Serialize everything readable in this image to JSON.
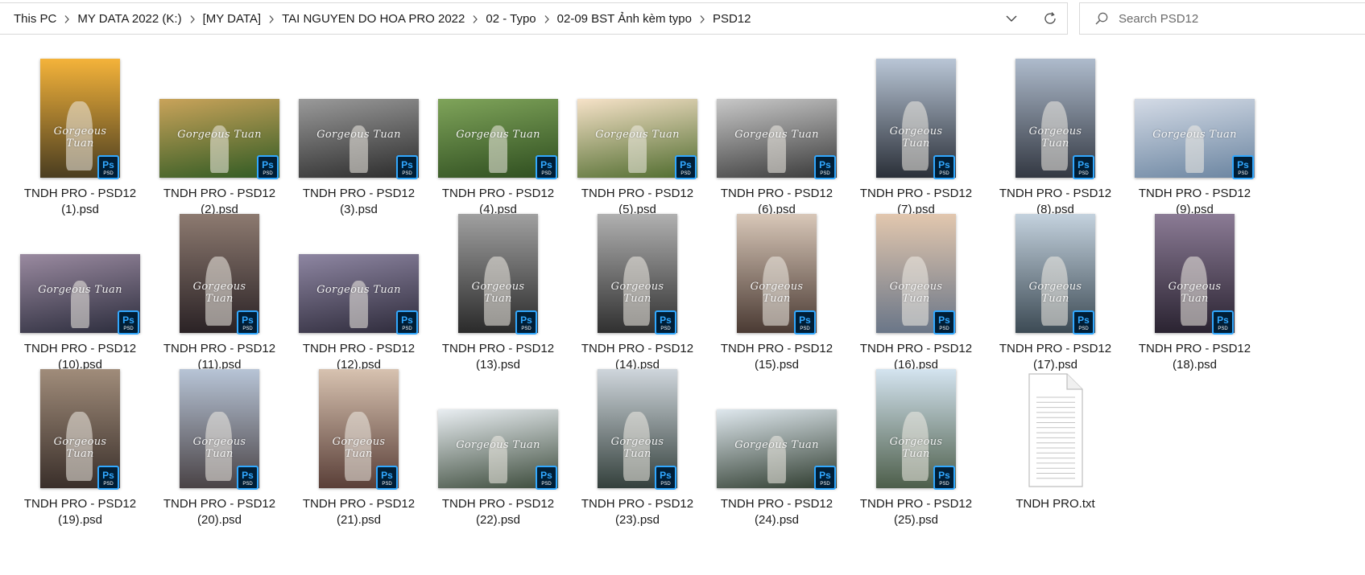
{
  "address_bar": {
    "breadcrumbs": [
      "This PC",
      "MY DATA 2022 (K:)",
      "[MY DATA]",
      "TAI NGUYEN DO HOA PRO 2022",
      "02 - Typo",
      "02-09 BST Ảnh kèm typo",
      "PSD12"
    ]
  },
  "search": {
    "placeholder": "Search PSD12"
  },
  "thumb_script": "Gorgeous Tuan",
  "ps_badge": {
    "top": "Ps",
    "bottom": "PSD"
  },
  "files": [
    {
      "line1": "TNDH PRO - PSD12",
      "line2": "(1).psd",
      "shape": "portrait",
      "c1": "#f4b33a",
      "c2": "#4a3d20"
    },
    {
      "line1": "TNDH PRO - PSD12",
      "line2": "(2).psd",
      "shape": "landscape",
      "c1": "#c9a35a",
      "c2": "#2f5a23"
    },
    {
      "line1": "TNDH PRO - PSD12",
      "line2": "(3).psd",
      "shape": "landscape",
      "c1": "#9a9a9a",
      "c2": "#2b2b2b"
    },
    {
      "line1": "TNDH PRO - PSD12",
      "line2": "(4).psd",
      "shape": "landscape",
      "c1": "#7fa45a",
      "c2": "#2e4d1f"
    },
    {
      "line1": "TNDH PRO - PSD12",
      "line2": "(5).psd",
      "shape": "landscape",
      "c1": "#f6e2c8",
      "c2": "#4f6b2d"
    },
    {
      "line1": "TNDH PRO - PSD12",
      "line2": "(6).psd",
      "shape": "landscape",
      "c1": "#c8c8c8",
      "c2": "#3a3a3a"
    },
    {
      "line1": "TNDH PRO - PSD12",
      "line2": "(7).psd",
      "shape": "portrait",
      "c1": "#b9c6d6",
      "c2": "#2a2f38"
    },
    {
      "line1": "TNDH PRO - PSD12",
      "line2": "(8).psd",
      "shape": "portrait",
      "c1": "#aebbcc",
      "c2": "#333842"
    },
    {
      "line1": "TNDH PRO - PSD12",
      "line2": "(9).psd",
      "shape": "landscape",
      "c1": "#d4dbe6",
      "c2": "#6a84a0"
    },
    {
      "line1": "TNDH PRO - PSD12",
      "line2": "(10).psd",
      "shape": "landscape",
      "c1": "#9a8aa0",
      "c2": "#2b2c3c"
    },
    {
      "line1": "TNDH PRO - PSD12",
      "line2": "(11).psd",
      "shape": "portrait",
      "c1": "#8d7a70",
      "c2": "#2a2225"
    },
    {
      "line1": "TNDH PRO - PSD12",
      "line2": "(12).psd",
      "shape": "landscape",
      "c1": "#8e86a2",
      "c2": "#2d2a3a"
    },
    {
      "line1": "TNDH PRO - PSD12",
      "line2": "(13).psd",
      "shape": "portrait",
      "c1": "#a0a0a0",
      "c2": "#2a2a2a"
    },
    {
      "line1": "TNDH PRO - PSD12",
      "line2": "(14).psd",
      "shape": "portrait",
      "c1": "#b0b0b0",
      "c2": "#303030"
    },
    {
      "line1": "TNDH PRO - PSD12",
      "line2": "(15).psd",
      "shape": "portrait",
      "c1": "#d8c7b8",
      "c2": "#4a3a33"
    },
    {
      "line1": "TNDH PRO - PSD12",
      "line2": "(16).psd",
      "shape": "portrait",
      "c1": "#e2c7ae",
      "c2": "#6a7688"
    },
    {
      "line1": "TNDH PRO - PSD12",
      "line2": "(17).psd",
      "shape": "portrait",
      "c1": "#c4d2de",
      "c2": "#3c4a54"
    },
    {
      "line1": "TNDH PRO - PSD12",
      "line2": "(18).psd",
      "shape": "portrait",
      "c1": "#8b7b95",
      "c2": "#2a2331"
    },
    {
      "line1": "TNDH PRO - PSD12",
      "line2": "(19).psd",
      "shape": "portrait",
      "c1": "#a08c7a",
      "c2": "#3a2f2a"
    },
    {
      "line1": "TNDH PRO - PSD12",
      "line2": "(20).psd",
      "shape": "portrait",
      "c1": "#b7c4d6",
      "c2": "#4a4346"
    },
    {
      "line1": "TNDH PRO - PSD12",
      "line2": "(21).psd",
      "shape": "portrait",
      "c1": "#d7c2b0",
      "c2": "#5a3f38"
    },
    {
      "line1": "TNDH PRO - PSD12",
      "line2": "(22).psd",
      "shape": "landscape",
      "c1": "#e9eef2",
      "c2": "#3b4a3a"
    },
    {
      "line1": "TNDH PRO - PSD12",
      "line2": "(23).psd",
      "shape": "portrait",
      "c1": "#cfd6dc",
      "c2": "#34403c"
    },
    {
      "line1": "TNDH PRO - PSD12",
      "line2": "(24).psd",
      "shape": "landscape",
      "c1": "#dfe8ee",
      "c2": "#2e3b2e"
    },
    {
      "line1": "TNDH PRO - PSD12",
      "line2": "(25).psd",
      "shape": "portrait",
      "c1": "#d4e4f0",
      "c2": "#4d5e4a"
    },
    {
      "line1": "TNDH PRO.txt",
      "line2": "",
      "shape": "txt",
      "c1": "#ffffff",
      "c2": "#ffffff"
    }
  ]
}
